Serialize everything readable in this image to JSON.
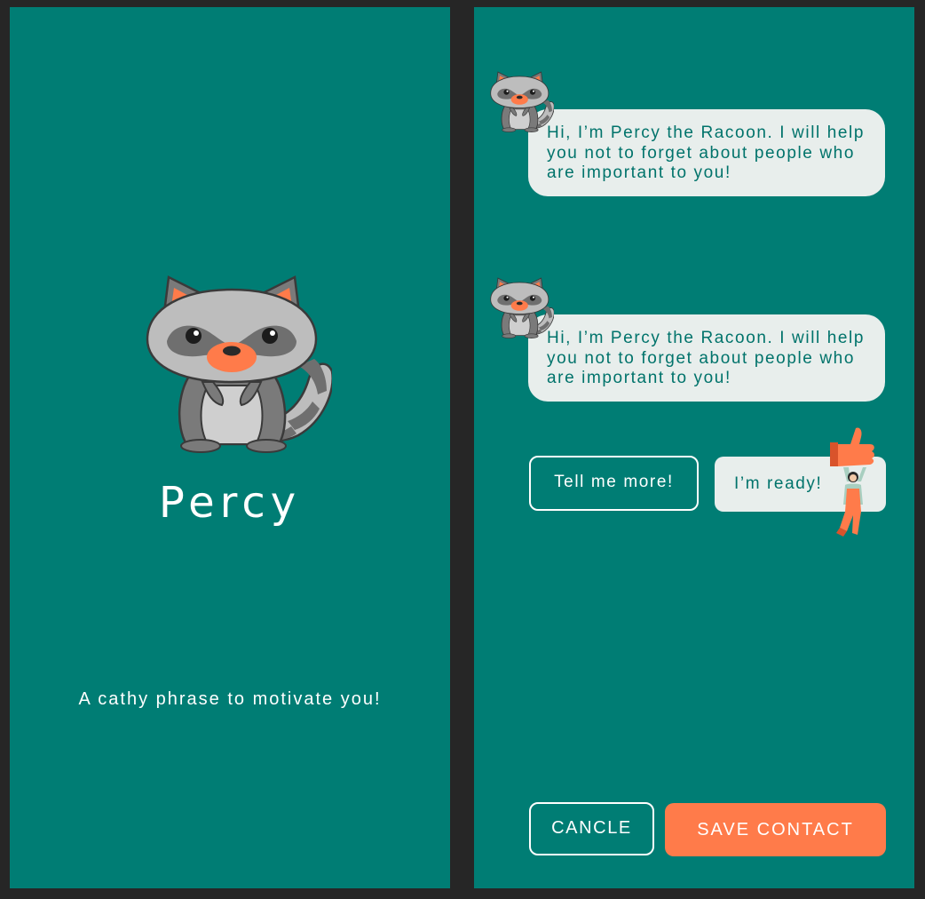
{
  "colors": {
    "background": "#262626",
    "screen": "#007d74",
    "bubble": "#e8eeec",
    "bubble_text": "#00736b",
    "accent": "#ff7b4a",
    "white": "#ffffff"
  },
  "splash": {
    "mascot_icon": "raccoon-mascot",
    "title": "Percy",
    "tagline": "A cathy phrase to motivate you!"
  },
  "chat": {
    "avatar_icon": "raccoon-avatar",
    "messages": [
      {
        "text": "Hi, I’m Percy the Racoon. I will help you not to forget about people who are important to you!"
      },
      {
        "text": "Hi, I’m Percy the Racoon. I will help you not to forget about people who are important to you!"
      }
    ],
    "replies": {
      "tell_more": "Tell me more!",
      "ready": "I’m ready!",
      "ready_illustration": "thumbs-up-person"
    },
    "actions": {
      "cancel": "CANCLE",
      "save": "SAVE CONTACT"
    }
  }
}
